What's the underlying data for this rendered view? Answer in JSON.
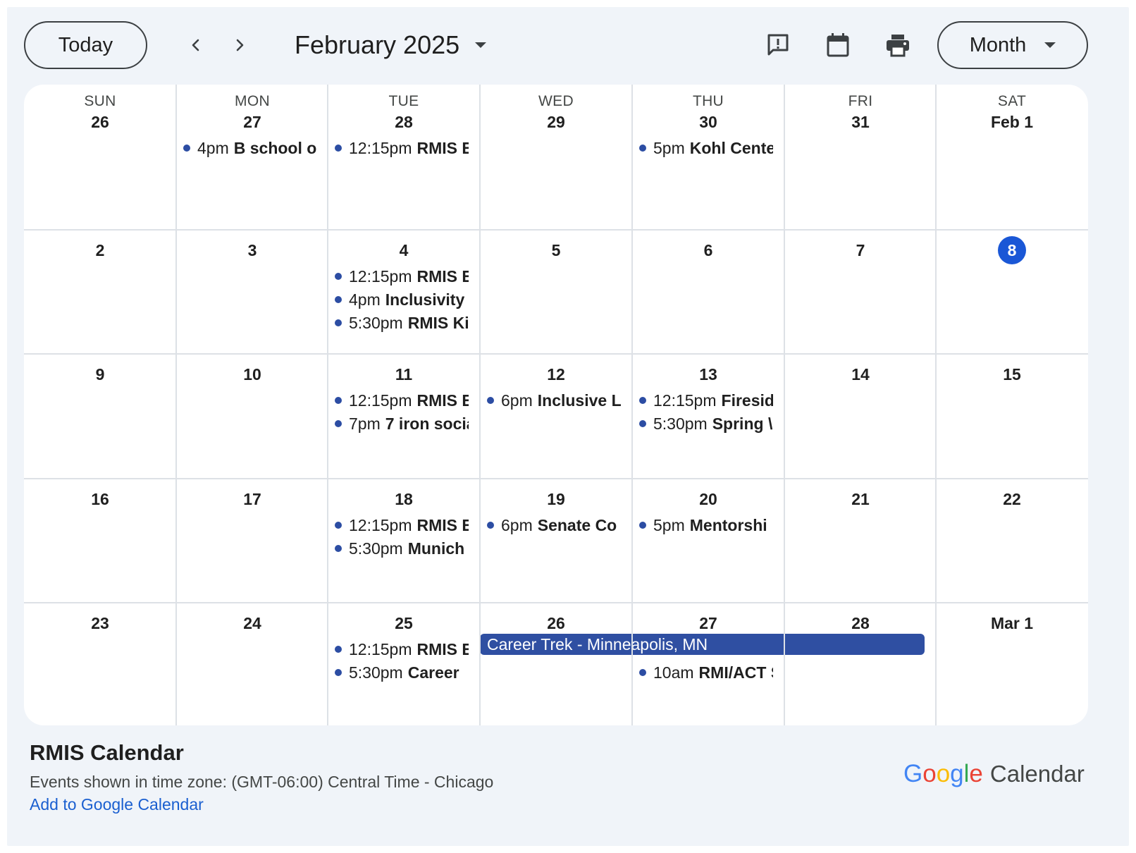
{
  "toolbar": {
    "today_label": "Today",
    "month_title": "February 2025",
    "view_label": "Month",
    "icons": [
      "chevron-left-icon",
      "chevron-right-icon",
      "feedback-icon",
      "calendar-icon",
      "print-icon"
    ]
  },
  "weekdays": [
    "SUN",
    "MON",
    "TUE",
    "WED",
    "THU",
    "FRI",
    "SAT"
  ],
  "weeks": [
    [
      {
        "day": "26",
        "events": []
      },
      {
        "day": "27",
        "events": [
          {
            "time": "4pm",
            "title": "B school o"
          }
        ]
      },
      {
        "day": "28",
        "events": [
          {
            "time": "12:15pm",
            "title": "RMIS E:"
          }
        ]
      },
      {
        "day": "29",
        "events": []
      },
      {
        "day": "30",
        "events": [
          {
            "time": "5pm",
            "title": "Kohl Cente"
          }
        ]
      },
      {
        "day": "31",
        "events": []
      },
      {
        "day": "Feb 1",
        "events": []
      }
    ],
    [
      {
        "day": "2",
        "events": []
      },
      {
        "day": "3",
        "events": []
      },
      {
        "day": "4",
        "events": [
          {
            "time": "12:15pm",
            "title": "RMIS E:"
          },
          {
            "time": "4pm",
            "title": "Inclusivity"
          },
          {
            "time": "5:30pm",
            "title": "RMIS Ki"
          }
        ]
      },
      {
        "day": "5",
        "events": []
      },
      {
        "day": "6",
        "events": []
      },
      {
        "day": "7",
        "events": []
      },
      {
        "day": "8",
        "today": true,
        "events": []
      }
    ],
    [
      {
        "day": "9",
        "events": []
      },
      {
        "day": "10",
        "events": []
      },
      {
        "day": "11",
        "events": [
          {
            "time": "12:15pm",
            "title": "RMIS E:"
          },
          {
            "time": "7pm",
            "title": "7 iron socia"
          }
        ]
      },
      {
        "day": "12",
        "events": [
          {
            "time": "6pm",
            "title": "Inclusive L"
          }
        ]
      },
      {
        "day": "13",
        "events": [
          {
            "time": "12:15pm",
            "title": "Fireside"
          },
          {
            "time": "5:30pm",
            "title": "Spring \\"
          }
        ]
      },
      {
        "day": "14",
        "events": []
      },
      {
        "day": "15",
        "events": []
      }
    ],
    [
      {
        "day": "16",
        "events": []
      },
      {
        "day": "17",
        "events": []
      },
      {
        "day": "18",
        "events": [
          {
            "time": "12:15pm",
            "title": "RMIS E:"
          },
          {
            "time": "5:30pm",
            "title": "Munich"
          }
        ]
      },
      {
        "day": "19",
        "events": [
          {
            "time": "6pm",
            "title": "Senate Co"
          }
        ]
      },
      {
        "day": "20",
        "events": [
          {
            "time": "5pm",
            "title": "Mentorshi"
          }
        ]
      },
      {
        "day": "21",
        "events": []
      },
      {
        "day": "22",
        "events": []
      }
    ],
    [
      {
        "day": "23",
        "events": []
      },
      {
        "day": "24",
        "events": []
      },
      {
        "day": "25",
        "events": [
          {
            "time": "12:15pm",
            "title": "RMIS E:"
          },
          {
            "time": "5:30pm",
            "title": "Career"
          }
        ]
      },
      {
        "day": "26",
        "events": []
      },
      {
        "day": "27",
        "events": [
          {
            "time": "10am",
            "title": "RMI/ACT S",
            "slot": 1
          }
        ]
      },
      {
        "day": "28",
        "events": []
      },
      {
        "day": "Mar 1",
        "events": []
      }
    ]
  ],
  "allday_event": {
    "title": "Career Trek - Minneapolis, MN"
  },
  "footer": {
    "calendar_name": "RMIS Calendar",
    "timezone_text": "Events shown in time zone: (GMT-06:00) Central Time - Chicago",
    "add_link": "Add to Google Calendar",
    "logo_word": "Google",
    "logo_product": "Calendar"
  },
  "colors": {
    "event_dot": "#2c4da3",
    "allday_bg": "#2f4fa2",
    "today_circle": "#1a57d6",
    "link": "#1a5fd0"
  }
}
